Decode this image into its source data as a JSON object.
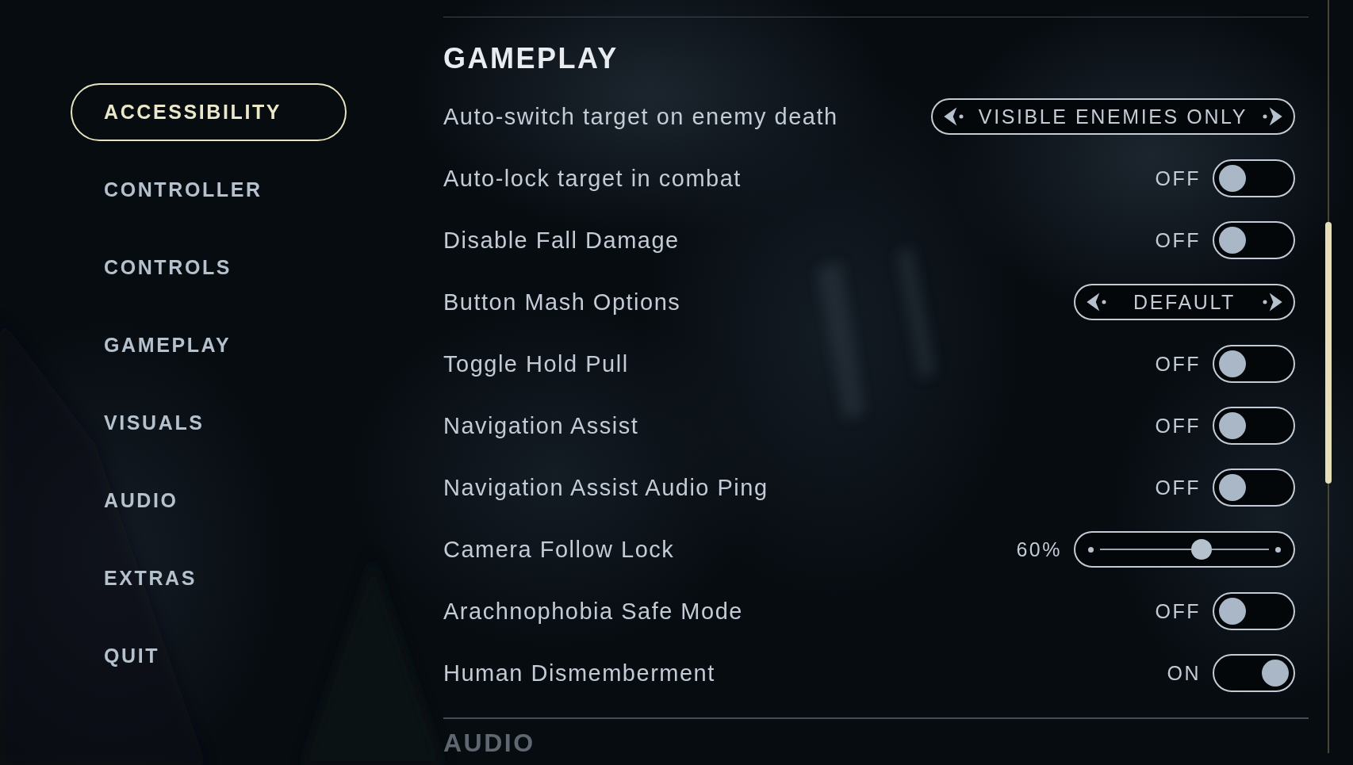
{
  "sidebar": {
    "items": [
      {
        "label": "ACCESSIBILITY",
        "selected": true
      },
      {
        "label": "CONTROLLER",
        "selected": false
      },
      {
        "label": "CONTROLS",
        "selected": false
      },
      {
        "label": "GAMEPLAY",
        "selected": false
      },
      {
        "label": "VISUALS",
        "selected": false
      },
      {
        "label": "AUDIO",
        "selected": false
      },
      {
        "label": "EXTRAS",
        "selected": false
      },
      {
        "label": "QUIT",
        "selected": false
      }
    ]
  },
  "section": {
    "title": "GAMEPLAY",
    "rows": [
      {
        "kind": "selector",
        "label": "Auto-switch target on enemy death",
        "value": "VISIBLE ENEMIES ONLY"
      },
      {
        "kind": "toggle",
        "label": "Auto-lock target in combat",
        "on": false,
        "state_label": "OFF"
      },
      {
        "kind": "toggle",
        "label": "Disable Fall Damage",
        "on": false,
        "state_label": "OFF"
      },
      {
        "kind": "selector",
        "label": "Button Mash Options",
        "value": "DEFAULT"
      },
      {
        "kind": "toggle",
        "label": "Toggle Hold Pull",
        "on": false,
        "state_label": "OFF"
      },
      {
        "kind": "toggle",
        "label": "Navigation Assist",
        "on": false,
        "state_label": "OFF"
      },
      {
        "kind": "toggle",
        "label": "Navigation Assist Audio Ping",
        "on": false,
        "state_label": "OFF"
      },
      {
        "kind": "slider",
        "label": "Camera Follow Lock",
        "level": 0.6,
        "reading": "60%"
      },
      {
        "kind": "toggle",
        "label": "Arachnophobia Safe Mode",
        "on": false,
        "state_label": "OFF"
      },
      {
        "kind": "toggle",
        "label": "Human Dismemberment",
        "on": true,
        "state_label": "ON"
      }
    ]
  },
  "next_section": {
    "title": "AUDIO"
  }
}
